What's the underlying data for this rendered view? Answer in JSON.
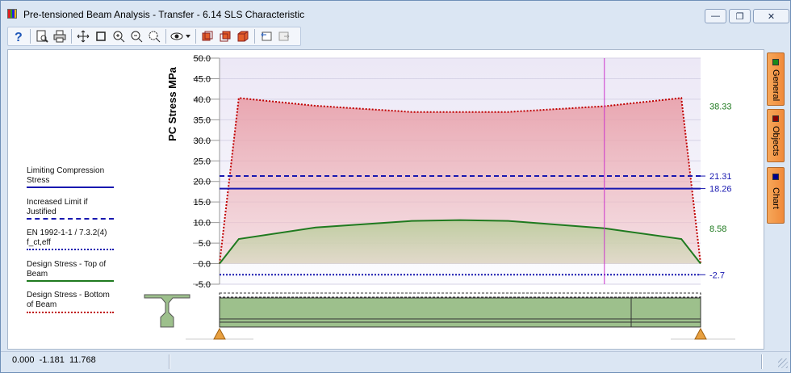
{
  "window": {
    "title": "Pre-tensioned Beam Analysis - Transfer - 6.14 SLS Characteristic",
    "controls": {
      "minimize": "—",
      "restore": "❐",
      "close": "✕"
    }
  },
  "toolbar": {
    "icons": [
      "help-icon",
      "print-preview-icon",
      "print-icon",
      "pan-icon",
      "select-box-icon",
      "zoom-in-icon",
      "zoom-out-icon",
      "zoom-extents-icon",
      "view-eye-icon",
      "view-front-icon",
      "view-side-icon",
      "view-3d-icon",
      "undo-view-icon",
      "redo-view-icon"
    ]
  },
  "legend": {
    "items": [
      {
        "label": "Limiting Compression Stress",
        "color": "#1818b0",
        "style": "solid"
      },
      {
        "label": "Increased Limit if Justified",
        "color": "#1818b0",
        "style": "dashed"
      },
      {
        "label": "EN 1992-1-1 / 7.3.2(4) f_ct,eff",
        "color": "#1818b0",
        "style": "dotted"
      },
      {
        "label": "Design Stress - Top of Beam",
        "color": "#1f7a1f",
        "style": "solid"
      },
      {
        "label": "Design Stress - Bottom of Beam",
        "color": "#c00000",
        "style": "dotted"
      }
    ]
  },
  "side_tabs": [
    {
      "label": "General",
      "color": "#1a8a1a"
    },
    {
      "label": "Objects",
      "color": "#8b0000"
    },
    {
      "label": "Chart",
      "color": "#00008b"
    }
  ],
  "status": {
    "coords": "0.000  -1.181  11.768"
  },
  "chart_data": {
    "type": "line",
    "ylabel": "PC Stress  MPa",
    "ylim": [
      -5,
      50
    ],
    "yticks": [
      "-5.0",
      "0.0",
      "5.0",
      "10.0",
      "15.0",
      "20.0",
      "25.0",
      "30.0",
      "35.0",
      "40.0",
      "45.0",
      "50.0"
    ],
    "ytick_values": [
      -5,
      0,
      5,
      10,
      15,
      20,
      25,
      30,
      35,
      40,
      45,
      50
    ],
    "xlim": [
      0,
      1
    ],
    "grid": true,
    "cursor_x": 0.8,
    "series": [
      {
        "name": "Design Stress - Bottom of Beam",
        "color": "#c00000",
        "style": "dotted",
        "fill": "#e9a5ad",
        "x": [
          0.0,
          0.04,
          0.2,
          0.4,
          0.6,
          0.8,
          0.96,
          1.0
        ],
        "y": [
          0.0,
          40.3,
          38.4,
          36.9,
          36.9,
          38.3,
          40.3,
          0.0
        ]
      },
      {
        "name": "Design Stress - Top of Beam",
        "color": "#1f7a1f",
        "style": "solid",
        "fill": "#b7cf9c",
        "x": [
          0.0,
          0.04,
          0.2,
          0.4,
          0.5,
          0.6,
          0.8,
          0.96,
          1.0
        ],
        "y": [
          0.0,
          6.0,
          8.8,
          10.4,
          10.6,
          10.4,
          8.6,
          6.0,
          0.0
        ]
      }
    ],
    "hlines": [
      {
        "name": "Increased Limit if Justified",
        "value": 21.31,
        "label": "21.31",
        "color": "#1818b0",
        "style": "dashed"
      },
      {
        "name": "Limiting Compression Stress",
        "value": 18.26,
        "label": "18.26",
        "color": "#1818b0",
        "style": "solid"
      },
      {
        "name": "EN 1992-1-1 / 7.3.2(4) f_ct,eff",
        "value": -2.7,
        "label": "-2.7",
        "color": "#1818b0",
        "style": "dotted"
      }
    ],
    "value_labels": [
      {
        "value": 38.33,
        "label": "38.33",
        "color": "#1f7a1f"
      },
      {
        "value": 8.58,
        "label": "8.58",
        "color": "#1f7a1f"
      }
    ]
  }
}
